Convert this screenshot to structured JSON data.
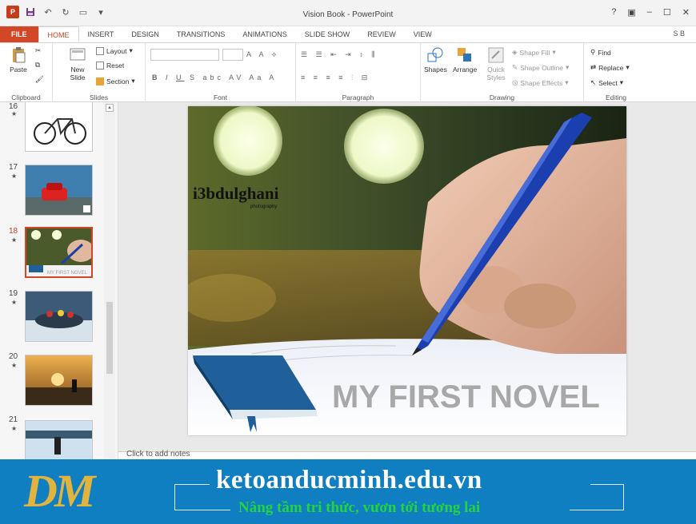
{
  "window": {
    "title": "Vision Book - PowerPoint",
    "help": "?",
    "signin": "S B"
  },
  "tabs": [
    {
      "label": "FILE"
    },
    {
      "label": "HOME"
    },
    {
      "label": "INSERT"
    },
    {
      "label": "DESIGN"
    },
    {
      "label": "TRANSITIONS"
    },
    {
      "label": "ANIMATIONS"
    },
    {
      "label": "SLIDE SHOW"
    },
    {
      "label": "REVIEW"
    },
    {
      "label": "VIEW"
    }
  ],
  "ribbon": {
    "clipboard": {
      "label": "Clipboard",
      "paste": "Paste"
    },
    "slides": {
      "label": "Slides",
      "new_slide": "New Slide",
      "layout": "Layout",
      "reset": "Reset",
      "section": "Section"
    },
    "font": {
      "label": "Font"
    },
    "paragraph": {
      "label": "Paragraph"
    },
    "drawing": {
      "label": "Drawing",
      "shapes": "Shapes",
      "arrange": "Arrange",
      "quick_styles": "Quick Styles",
      "shape_fill": "Shape Fill",
      "shape_outline": "Shape Outline",
      "shape_effects": "Shape Effects"
    },
    "editing": {
      "label": "Editing",
      "find": "Find",
      "replace": "Replace",
      "select": "Select"
    }
  },
  "thumbnails": [
    {
      "number": "16"
    },
    {
      "number": "17"
    },
    {
      "number": "18",
      "selected": true,
      "caption": "MY FIRST NOVEL"
    },
    {
      "number": "19"
    },
    {
      "number": "20"
    },
    {
      "number": "21"
    }
  ],
  "slide": {
    "watermark": "i3bdulghani",
    "watermark_sub": "photography",
    "title": "MY FIRST NOVEL"
  },
  "notes": {
    "placeholder": "Click to add notes"
  },
  "banner": {
    "logo": "DM",
    "site": "ketoanducminh.edu.vn",
    "tagline": "Nâng tầm tri thức, vươn tới tương lai"
  },
  "colors": {
    "accent": "#d24726",
    "banner": "#0f7fc2",
    "tagline": "#24d43c",
    "logo": "#e0b43e"
  }
}
